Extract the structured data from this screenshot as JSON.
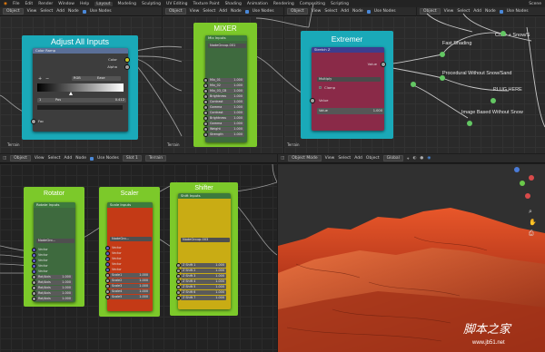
{
  "topbar": {
    "menu": [
      "File",
      "Edit",
      "Render",
      "Window",
      "Help"
    ],
    "workspaces": [
      "Layout",
      "Modeling",
      "Sculpting",
      "UV Editing",
      "Texture Paint",
      "Shading",
      "Animation",
      "Rendering",
      "Compositing",
      "Scripting"
    ],
    "active_workspace": "Layout",
    "scene": "Scene"
  },
  "editor_header": {
    "mode": "Object",
    "menus": [
      "View",
      "Select",
      "Add",
      "Node"
    ],
    "use_nodes": "Use Nodes",
    "slot": "Slot 1",
    "material": "Terrain",
    "global": "Global",
    "viewport_mode": "Object Mode"
  },
  "frame_labels": {
    "terrain": "Terrain"
  },
  "adjust": {
    "title": "Adjust All Inputs",
    "node": "Color Ramp",
    "out_color": "Color",
    "out_alpha": "Alpha",
    "mode": "RGB",
    "interp": "Ease",
    "pos_index": "1",
    "pos_label": "Pos",
    "pos_value": "0.412",
    "fac": "Fac"
  },
  "mixer": {
    "title": "MIXER",
    "node": "Mix Inputs",
    "group": "NodeGroup.001",
    "rows": [
      {
        "label": "Mix_01",
        "value": "1.000"
      },
      {
        "label": "Mix_02",
        "value": "1.000"
      },
      {
        "label": "Mix_03_CB",
        "value": "1.000"
      },
      {
        "label": "Brightness",
        "value": "1.000"
      },
      {
        "label": "Contrast",
        "value": "1.000"
      },
      {
        "label": "Gamma",
        "value": "1.000"
      },
      {
        "label": "Contrast",
        "value": "1.000"
      },
      {
        "label": "Brightness",
        "value": "1.000"
      },
      {
        "label": "Gamma",
        "value": "1.000"
      },
      {
        "label": "Weight",
        "value": "1.000"
      },
      {
        "label": "Strength",
        "value": "1.000"
      }
    ]
  },
  "extremer": {
    "title": "Extremer",
    "node": "Stretch Z",
    "out_value": "Value",
    "blend": "Multiply",
    "clamp": "Clamp",
    "in_value": "Value",
    "value_label": "Value",
    "value": "1.000"
  },
  "right_labels": {
    "fast_shading": "Fast Shading",
    "color_snow": "Color + Snow/S",
    "procedural": "Procedural Without Snow/Sand",
    "plug_here": "PLUG HERE",
    "image_based": "Image Based Without Snow"
  },
  "rotator": {
    "title": "Rotator",
    "node": "Rotate Inputs",
    "group": "NodeGro...",
    "inputs": [
      "Vector",
      "Vector",
      "Vector",
      "Vector",
      "Vector"
    ],
    "rows": [
      {
        "label": "Rot/Axis",
        "value": "1.000"
      },
      {
        "label": "Rot/Axis",
        "value": "1.000"
      },
      {
        "label": "Rot/Axis",
        "value": "1.000"
      },
      {
        "label": "Rot/Axis",
        "value": "1.000"
      },
      {
        "label": "Rot/Axis",
        "value": "1.000"
      }
    ]
  },
  "scaler": {
    "title": "Scaler",
    "node": "Scale Inputs",
    "group": "NodeGro...",
    "inputs": [
      "Vector",
      "Vector",
      "Vector",
      "Vector",
      "Vector"
    ],
    "rows": [
      {
        "label": "Scale1",
        "value": "1.000"
      },
      {
        "label": "Scale2",
        "value": "1.000"
      },
      {
        "label": "Scale3",
        "value": "1.000"
      },
      {
        "label": "Scale4",
        "value": "1.000"
      },
      {
        "label": "Scale5",
        "value": "1.000"
      }
    ]
  },
  "shifter": {
    "title": "Shifter",
    "node": "Shift Inputs",
    "group": "NodeGroup.003",
    "rows": [
      {
        "label": "Z Shift 1",
        "value": "1.000"
      },
      {
        "label": "Z Shift 2",
        "value": "1.000"
      },
      {
        "label": "Z Shift 3",
        "value": "1.000"
      },
      {
        "label": "Z Shift 4",
        "value": "1.000"
      },
      {
        "label": "Z Shift 5",
        "value": "1.000"
      },
      {
        "label": "Z Shift 6",
        "value": "1.000"
      },
      {
        "label": "Z Shift 7",
        "value": "1.000"
      }
    ]
  },
  "watermark": {
    "title": "脚本之家",
    "url": "www.jb51.net"
  }
}
